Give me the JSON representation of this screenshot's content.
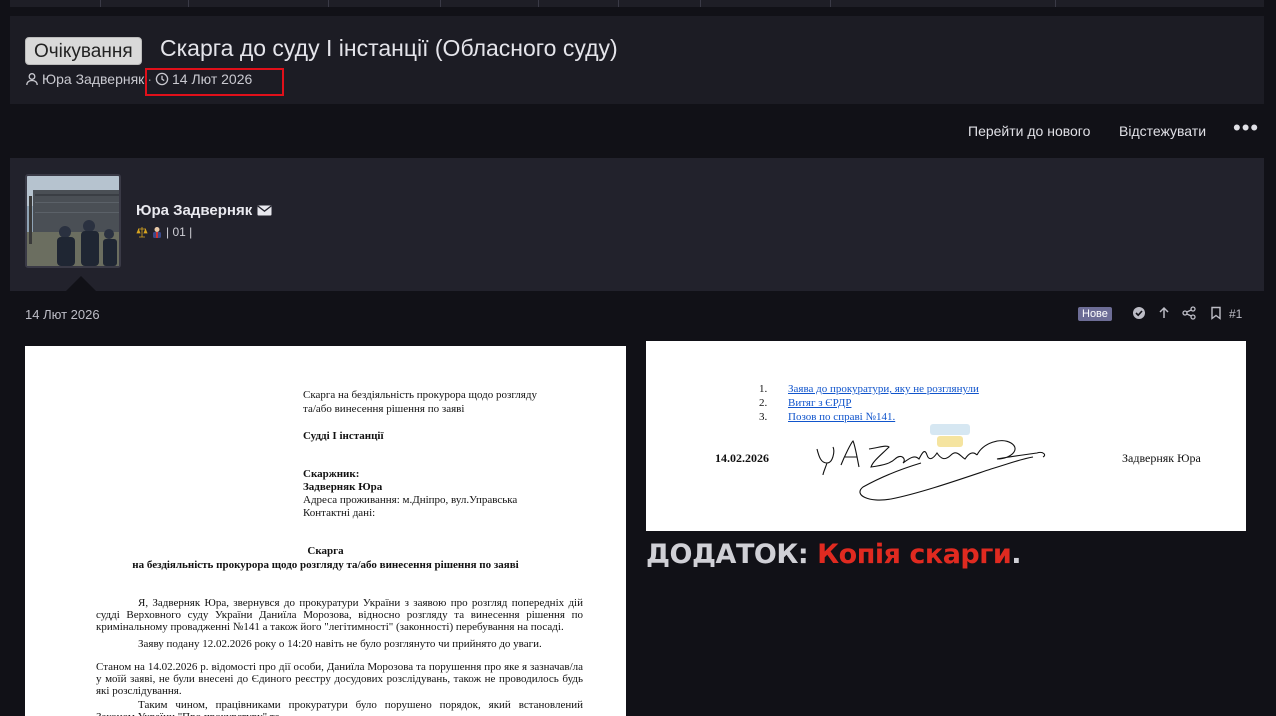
{
  "thread": {
    "status_label": "Очікування",
    "title": "Скарга до суду І інстанції (Обласного суду)",
    "author": "Юра Задверняк",
    "date": "14 Лют 2026"
  },
  "actions": {
    "goto_new": "Перейти до нового",
    "watch": "Відстежувати",
    "more": "•••"
  },
  "user": {
    "name": "Юра Задверняк",
    "badges_text": "| 01 |"
  },
  "post": {
    "date": "14 Лют 2026",
    "new_label": "Нове",
    "number": "#1"
  },
  "doc1": {
    "head1": "Скарга на бездіяльність прокурора щодо розгляду",
    "head2": "та/або  винесення рішення по заяві",
    "to": "Судді І інстанції",
    "complainant_label": "Скаржник:",
    "complainant_name": "Задверняк Юра",
    "address": "Адреса проживання: м.Дніпро, вул.Управська",
    "contacts": "Контактні дані:",
    "title1": "Скарга",
    "title2": "на бездіяльність прокурора щодо розгляду та/або  винесення рішення по заяві",
    "para1": "Я, Задверняк Юра, звернувся  до прокуратури України з заявою про розгляд попередніх дій судді Верховного суду України Даниїла Морозова, відносно розгляду та винесення рішення по кримінальному провадженні №141 а також його \"легітимності\" (законності) перебування на посаді.",
    "para2": "Заяву подану 12.02.2026 року о 14:20 навіть не було розглянуто чи прийнято до уваги.",
    "para3": "Станом на 14.02.2026 р. відомості про дії особи, Даниїла Морозова та порушення про яке я зазначав/ла у моїй заяві, не були внесені до Єдиного реєстру досудових розслідувань, також не проводилось будь які розслідування.",
    "para4": "Таким чином, працівниками прокуратури було порушено порядок, який встановлений Законом України \"Про прокуратуру\" та ..."
  },
  "doc2": {
    "items": [
      {
        "num": "1.",
        "text": "Заява до прокуратури, яку не розглянули"
      },
      {
        "num": "2.",
        "text": "Витяг з ЄРДР"
      },
      {
        "num": "3.",
        "text": "Позов по справі №141."
      }
    ],
    "date": "14.02.2026",
    "signer": "Задверняк Юра"
  },
  "annex": {
    "label": "ДОДАТОК:",
    "value": "Копія скарги",
    "dot": "."
  },
  "colors": {
    "highlight": "#e0101a",
    "annex_red": "#e02a20",
    "new_badge": "#6d6d96"
  }
}
